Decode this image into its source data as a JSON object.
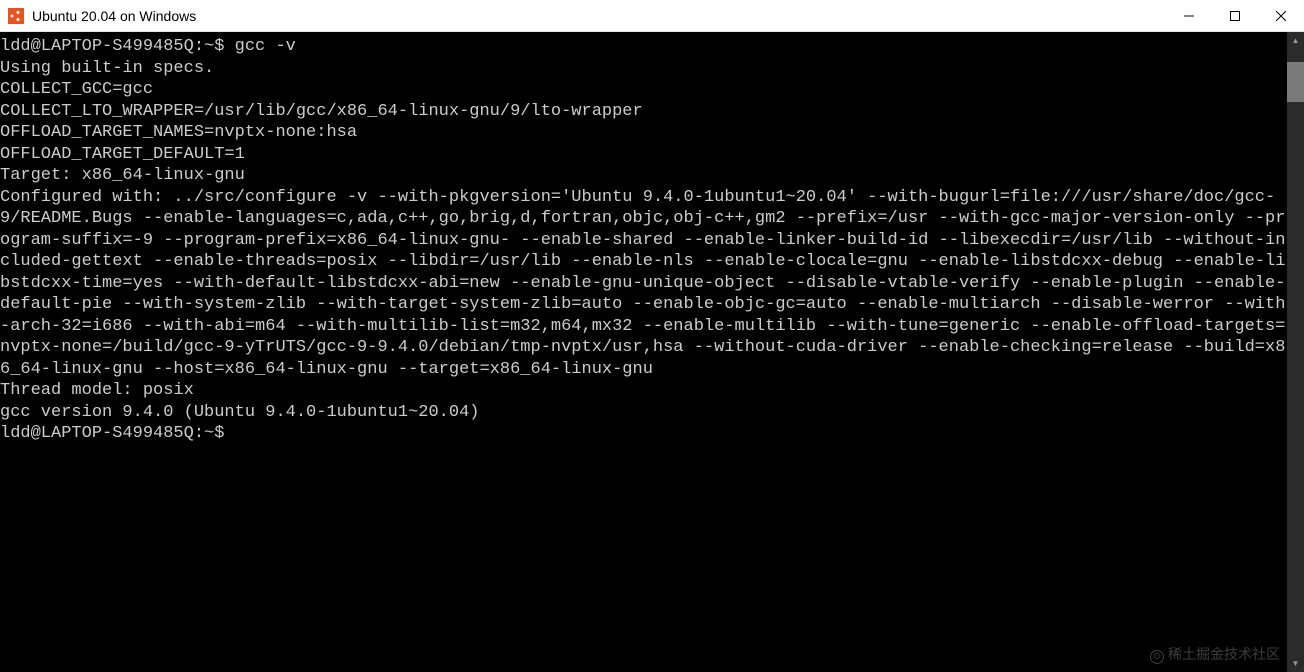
{
  "window": {
    "title": "Ubuntu 20.04 on Windows"
  },
  "terminal": {
    "prompt1_user": "ldd@LAPTOP-S499485Q",
    "prompt1_path": "~",
    "prompt1_symbol": "$ ",
    "command1": "gcc -v",
    "line2": "Using built-in specs.",
    "line3": "COLLECT_GCC=gcc",
    "line4": "COLLECT_LTO_WRAPPER=/usr/lib/gcc/x86_64-linux-gnu/9/lto-wrapper",
    "line5": "OFFLOAD_TARGET_NAMES=nvptx-none:hsa",
    "line6": "OFFLOAD_TARGET_DEFAULT=1",
    "line7": "Target: x86_64-linux-gnu",
    "configured": "Configured with: ../src/configure -v --with-pkgversion='Ubuntu 9.4.0-1ubuntu1~20.04' --with-bugurl=file:///usr/share/doc/gcc-9/README.Bugs --enable-languages=c,ada,c++,go,brig,d,fortran,objc,obj-c++,gm2 --prefix=/usr --with-gcc-major-version-only --program-suffix=-9 --program-prefix=x86_64-linux-gnu- --enable-shared --enable-linker-build-id --libexecdir=/usr/lib --without-included-gettext --enable-threads=posix --libdir=/usr/lib --enable-nls --enable-clocale=gnu --enable-libstdcxx-debug --enable-libstdcxx-time=yes --with-default-libstdcxx-abi=new --enable-gnu-unique-object --disable-vtable-verify --enable-plugin --enable-default-pie --with-system-zlib --with-target-system-zlib=auto --enable-objc-gc=auto --enable-multiarch --disable-werror --with-arch-32=i686 --with-abi=m64 --with-multilib-list=m32,m64,mx32 --enable-multilib --with-tune=generic --enable-offload-targets=nvptx-none=/build/gcc-9-yTrUTS/gcc-9-9.4.0/debian/tmp-nvptx/usr,hsa --without-cuda-driver --enable-checking=release --build=x86_64-linux-gnu --host=x86_64-linux-gnu --target=x86_64-linux-gnu",
    "line_thread": "Thread model: posix",
    "line_version": "gcc version 9.4.0 (Ubuntu 9.4.0-1ubuntu1~20.04)",
    "prompt2_user": "ldd@LAPTOP-S499485Q",
    "prompt2_path": "~",
    "prompt2_symbol": "$ "
  },
  "watermark": {
    "text": "稀土掘金技术社区"
  }
}
